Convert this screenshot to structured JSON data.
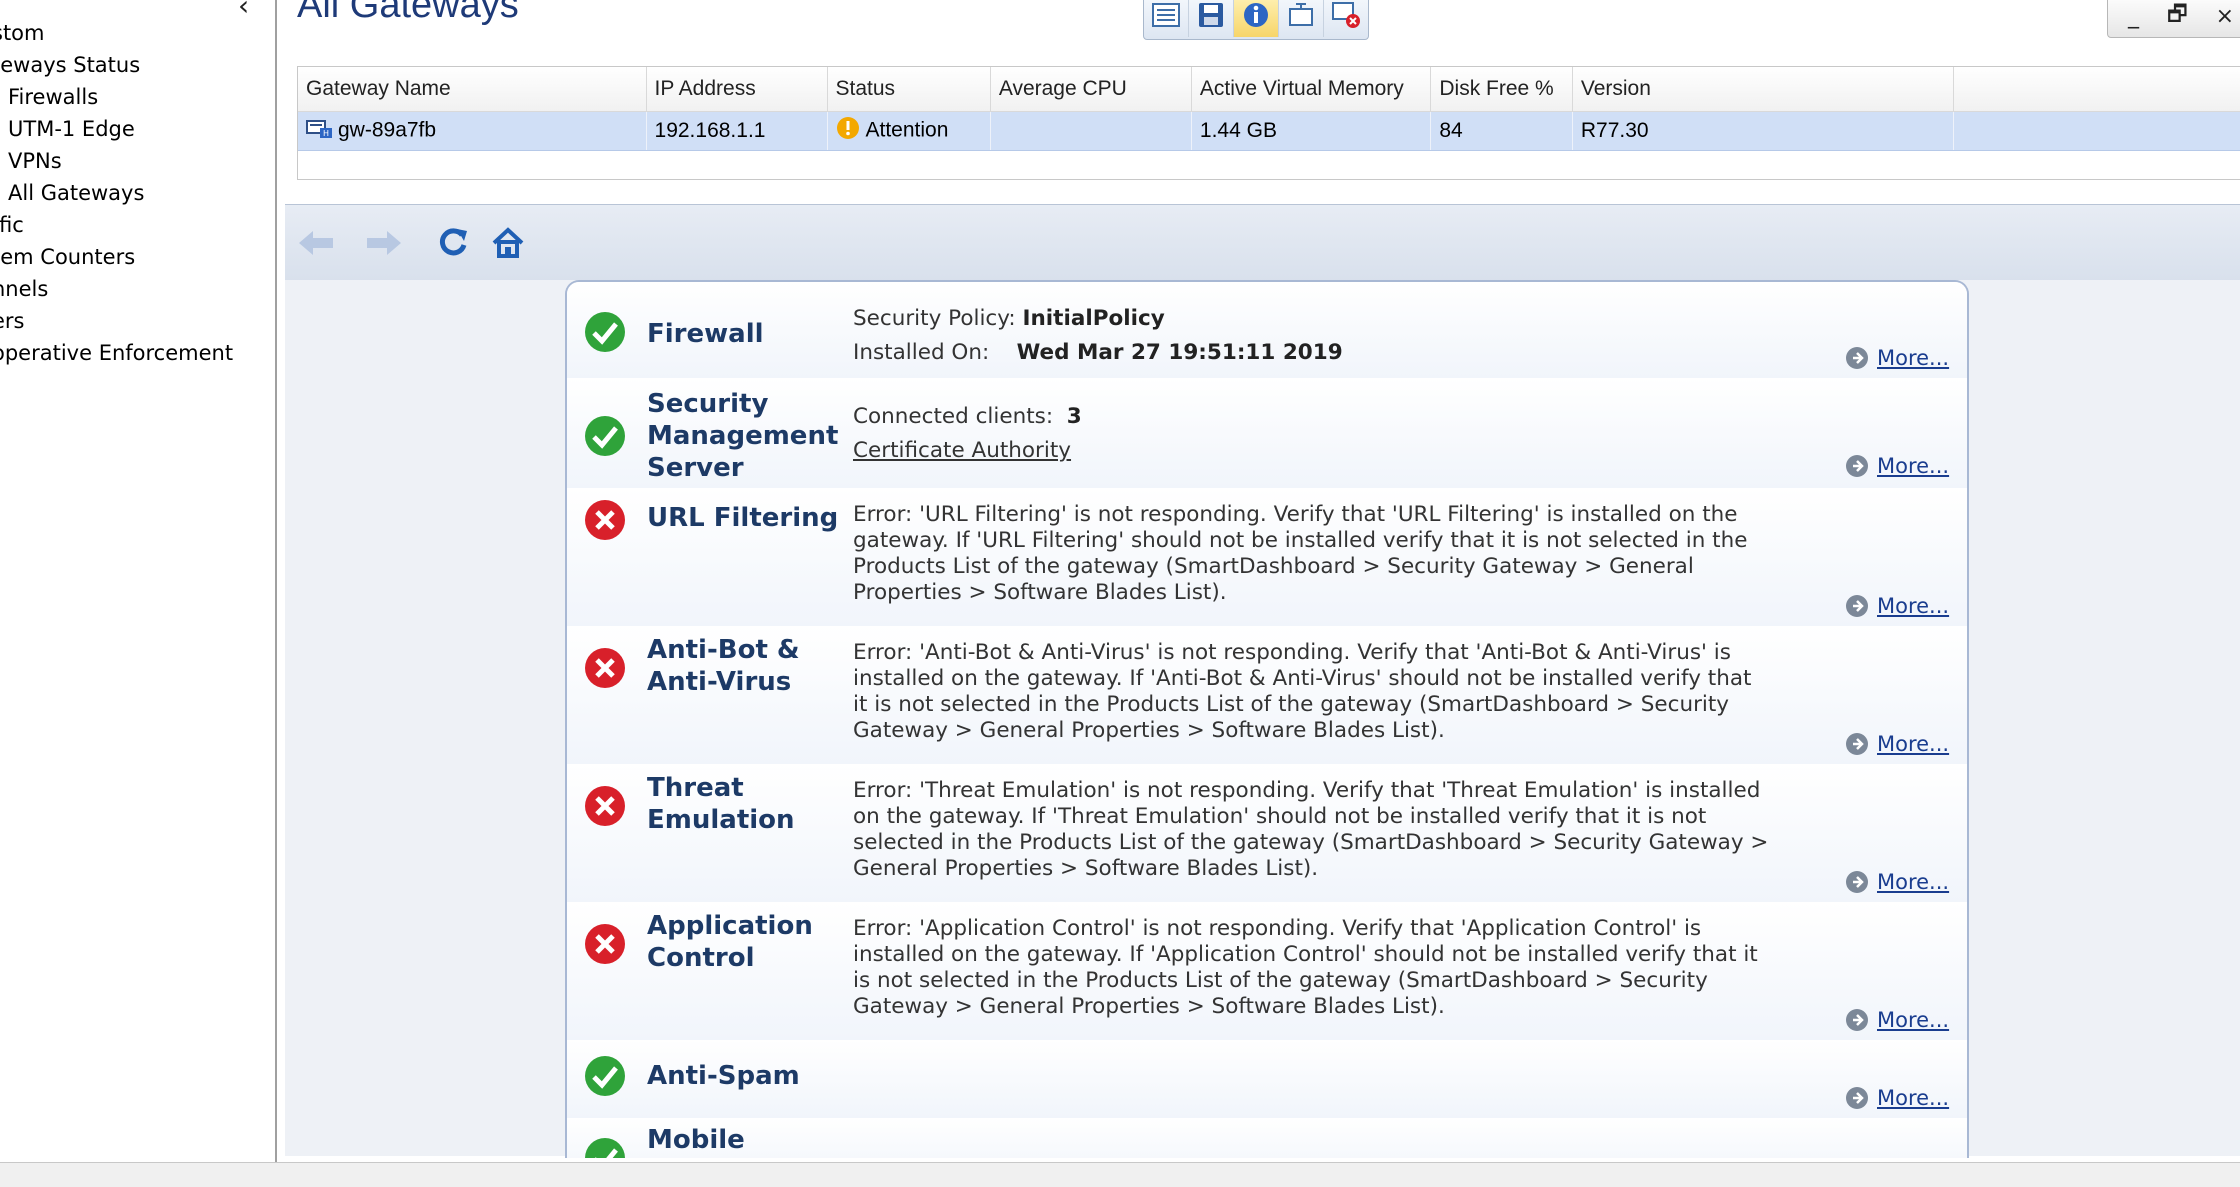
{
  "sidebar": {
    "items": [
      {
        "label": "stom",
        "level": "top"
      },
      {
        "label": "teways Status",
        "level": "top"
      },
      {
        "label": "Firewalls",
        "level": "sub"
      },
      {
        "label": "UTM-1 Edge",
        "level": "sub"
      },
      {
        "label": "VPNs",
        "level": "sub"
      },
      {
        "label": "All Gateways",
        "level": "sub"
      },
      {
        "label": "ffic",
        "level": "top"
      },
      {
        "label": "tem Counters",
        "level": "top"
      },
      {
        "label": "nnels",
        "level": "top"
      },
      {
        "label": "ers",
        "level": "top"
      },
      {
        "label": "operative Enforcement",
        "level": "top"
      }
    ]
  },
  "header": {
    "title": "All Gateways"
  },
  "toolbar": {
    "buttons": [
      "list-view-icon",
      "save-icon",
      "info-icon",
      "tree-view-icon",
      "remove-icon"
    ],
    "active": "info-icon"
  },
  "window_controls": {
    "minimize": "_",
    "restore": "🗗",
    "close": "×"
  },
  "grid": {
    "columns": [
      "Gateway Name",
      "IP Address",
      "Status",
      "Average CPU",
      "Active Virtual Memory",
      "Disk Free %",
      "Version"
    ],
    "rows": [
      {
        "gateway_name": "gw-89a7fb",
        "ip_address": "192.168.1.1",
        "status": "Attention",
        "average_cpu": "",
        "active_virtual_memory": "1.44 GB",
        "disk_free": "84",
        "version": "R77.30"
      }
    ]
  },
  "nav": {
    "buttons": [
      "back-icon",
      "forward-icon",
      "refresh-icon",
      "home-icon"
    ]
  },
  "blades": {
    "firewall": {
      "name": "Firewall",
      "status": "ok",
      "policy_label": "Security Policy:",
      "policy_value": "InitialPolicy",
      "installed_label": "Installed On:",
      "installed_value": "Wed Mar 27 19:51:11 2019",
      "more": "More..."
    },
    "smc": {
      "name_line1": "Security",
      "name_line2": "Management",
      "name_line3": "Server",
      "status": "ok",
      "clients_label": "Connected clients:",
      "clients_value": "3",
      "ca_link": "Certificate Authority",
      "more": "More..."
    },
    "url_filtering": {
      "name": "URL Filtering",
      "status": "error",
      "message_lines": [
        "Error: 'URL Filtering' is not responding. Verify that 'URL Filtering' is installed on the",
        "gateway. If 'URL Filtering' should not be installed verify that it is not selected in the",
        "Products List of the gateway (SmartDashboard > Security Gateway > General",
        "Properties > Software Blades List)."
      ],
      "more": "More..."
    },
    "anti_bot": {
      "name_line1": "Anti-Bot &",
      "name_line2": "Anti-Virus",
      "status": "error",
      "message_lines": [
        "Error: 'Anti-Bot & Anti-Virus' is not responding. Verify that 'Anti-Bot & Anti-Virus' is",
        "installed on the gateway. If 'Anti-Bot & Anti-Virus' should not be installed verify that",
        "it is not selected in the Products List of the gateway (SmartDashboard > Security",
        "Gateway > General Properties > Software Blades List)."
      ],
      "more": "More..."
    },
    "threat_emulation": {
      "name_line1": "Threat",
      "name_line2": "Emulation",
      "status": "error",
      "message_lines": [
        "Error: 'Threat Emulation' is not responding. Verify that 'Threat Emulation' is installed",
        "on the gateway. If 'Threat Emulation' should not be installed verify that it is not",
        "selected in the Products List of the gateway (SmartDashboard > Security Gateway >",
        "General Properties > Software Blades List)."
      ],
      "more": "More..."
    },
    "app_control": {
      "name_line1": "Application",
      "name_line2": "Control",
      "status": "error",
      "message_lines": [
        "Error: 'Application Control' is not responding. Verify that 'Application Control' is",
        "installed on the gateway. If 'Application Control' should not be installed verify that it",
        "is not selected in the Products List of the gateway (SmartDashboard > Security",
        "Gateway > General Properties > Software Blades List)."
      ],
      "more": "More..."
    },
    "anti_spam": {
      "name": "Anti-Spam",
      "status": "ok",
      "more": "More..."
    },
    "mobile": {
      "name": "Mobile",
      "status": "ok"
    }
  },
  "colors": {
    "ok": "#2fa33a",
    "error": "#d8202a",
    "attention": "#f3a800",
    "selected_row": "#d0dff6",
    "title": "#1e3a78",
    "blade_text": "#1d3a66",
    "link": "#1a3d8f"
  }
}
